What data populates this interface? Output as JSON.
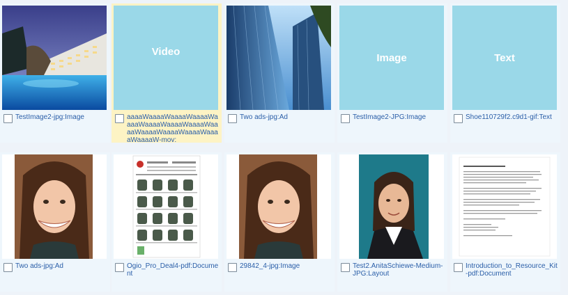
{
  "items": [
    {
      "label": "TestImage2-jpg:Image",
      "kind": "photo-hotel"
    },
    {
      "label": "aaaaWaaaaWaaaaWaaaaWaaaaWaaaaWaaaaWaaaaWaaaaWaaaaWaaaaWaaaaWaaaaWaaaaW-mov:",
      "kind": "placeholder",
      "placeholder_text": "Video",
      "selected": true
    },
    {
      "label": "Two ads-jpg:Ad",
      "kind": "photo-buildings"
    },
    {
      "label": "TestImage2-JPG:Image",
      "kind": "placeholder",
      "placeholder_text": "Image"
    },
    {
      "label": "Shoe110729f2.c9d1-gif:Text",
      "kind": "placeholder",
      "placeholder_text": "Text"
    },
    {
      "label": "Two ads-jpg:Ad",
      "kind": "photo-woman1"
    },
    {
      "label": "Ogio_Pro_Deal4-pdf:Document",
      "kind": "doc-catalog"
    },
    {
      "label": "29842_4-jpg:Image",
      "kind": "photo-woman1"
    },
    {
      "label": "Test2.AnitaSchiewe-Medium-JPG:Layout",
      "kind": "photo-woman2"
    },
    {
      "label": "Introduction_to_Resource_Kit-pdf:Document",
      "kind": "doc-text"
    }
  ],
  "colors": {
    "placeholder": "#9ad8e8",
    "selected": "#fdf3c4",
    "cell": "#eef6fc",
    "link": "#2a5ea8"
  }
}
